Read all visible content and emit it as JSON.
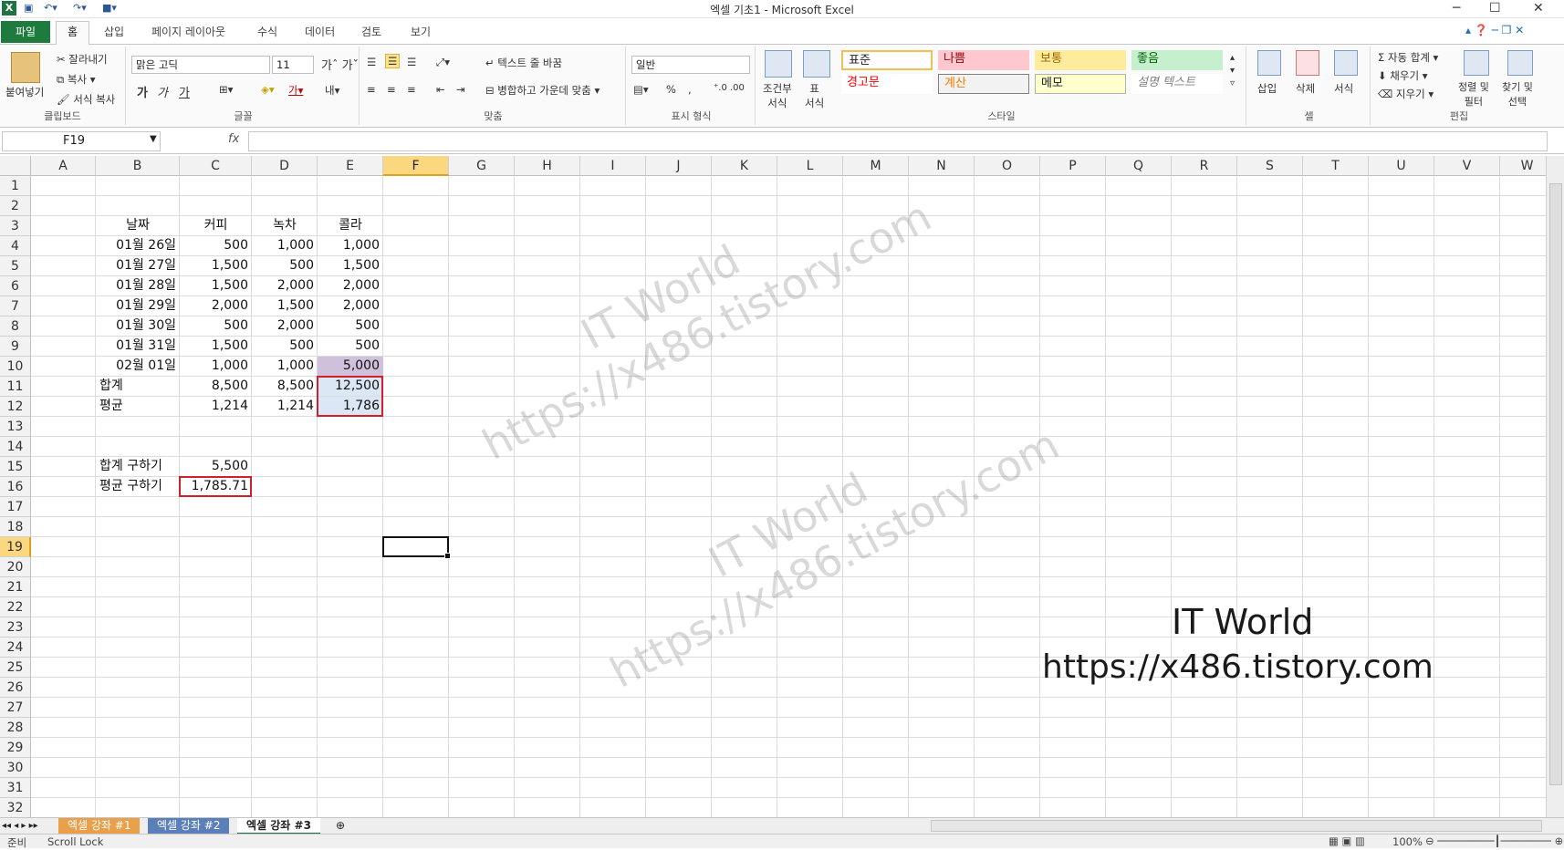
{
  "window": {
    "title": "엑셀 기초1 - Microsoft Excel",
    "minimize": "─",
    "maximize": "☐",
    "close": "✕",
    "app_icon": "X"
  },
  "ribbon_tabs": [
    "파일",
    "홈",
    "삽입",
    "페이지 레이아웃",
    "수식",
    "데이터",
    "검토",
    "보기"
  ],
  "ribbon": {
    "clipboard": {
      "paste": "붙여넣기",
      "cut": "잘라내기",
      "copy": "복사 ▾",
      "format_painter": "서식 복사",
      "label": "클립보드"
    },
    "font": {
      "name": "맑은 고딕",
      "size": "11",
      "bold": "가",
      "italic": "가",
      "underline": "가",
      "label": "글꼴"
    },
    "alignment": {
      "wrap": "텍스트 줄 바꿈",
      "merge": "병합하고 가운데 맞춤",
      "label": "맞춤"
    },
    "number": {
      "format": "일반",
      "percent": "%",
      "comma": ",",
      "label": "표시 형식"
    },
    "styles": {
      "conditional": "조건부\n서식",
      "table": "표\n서식",
      "normal": "표준",
      "bad": "나쁨",
      "neutral": "보통",
      "good": "좋음",
      "warning": "경고문",
      "calc": "계산",
      "memo": "메모",
      "explanatory": "설명 텍스트",
      "label": "스타일"
    },
    "cells": {
      "insert": "삽입",
      "delete": "삭제",
      "format": "서식",
      "label": "셀"
    },
    "editing": {
      "autosum": "자동 합계",
      "fill": "채우기",
      "clear": "지우기",
      "sort": "정렬 및\n필터",
      "find": "찾기 및\n선택",
      "label": "편집"
    }
  },
  "formula_bar": {
    "name_box": "F19",
    "fx": "fx",
    "formula": ""
  },
  "columns": [
    "A",
    "B",
    "C",
    "D",
    "E",
    "F",
    "G",
    "H",
    "I",
    "J",
    "K",
    "L",
    "M",
    "N",
    "O",
    "P",
    "Q",
    "R",
    "S",
    "T",
    "U",
    "V",
    "W"
  ],
  "selected_column": "F",
  "selected_row": 19,
  "rows": [
    1,
    2,
    3,
    4,
    5,
    6,
    7,
    8,
    9,
    10,
    11,
    12,
    13,
    14,
    15,
    16,
    17,
    18,
    19,
    20,
    21,
    22,
    23,
    24,
    25,
    26,
    27,
    28,
    29,
    30,
    31,
    32
  ],
  "table": {
    "headers": [
      "날짜",
      "커피",
      "녹차",
      "콜라"
    ],
    "data": [
      [
        "01월 26일",
        "500",
        "1,000",
        "1,000"
      ],
      [
        "01월 27일",
        "1,500",
        "500",
        "1,500"
      ],
      [
        "01월 28일",
        "1,500",
        "2,000",
        "2,000"
      ],
      [
        "01월 29일",
        "2,000",
        "1,500",
        "2,000"
      ],
      [
        "01월 30일",
        "500",
        "2,000",
        "500"
      ],
      [
        "01월 31일",
        "1,500",
        "500",
        "500"
      ],
      [
        "02월 01일",
        "1,000",
        "1,000",
        "5,000"
      ]
    ],
    "sum_label": "합계",
    "sum": [
      "8,500",
      "8,500",
      "12,500"
    ],
    "avg_label": "평균",
    "avg": [
      "1,214",
      "1,214",
      "1,786"
    ]
  },
  "extra": {
    "sum_label": "합계 구하기",
    "sum_value": "5,500",
    "avg_label": "평균 구하기",
    "avg_value": "1,785.71"
  },
  "watermark": {
    "brand": "IT World",
    "url": "https://x486.tistory.com"
  },
  "sheet_tabs": [
    "엑셀 강좌 #1",
    "엑셀 강좌 #2",
    "엑셀 강좌 #3"
  ],
  "active_sheet": "엑셀 강좌 #3",
  "status": {
    "ready": "준비",
    "scroll_lock": "Scroll Lock",
    "zoom": "100%"
  }
}
